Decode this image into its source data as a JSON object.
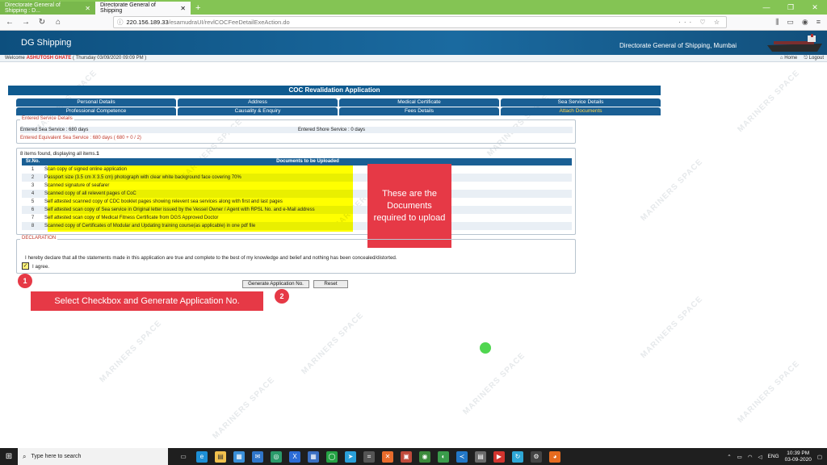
{
  "browser": {
    "tabs": [
      {
        "label": "Directorate General of Shipping : D..."
      },
      {
        "label": "Directorate General of Shipping"
      }
    ],
    "url_host": "220.156.189.33",
    "url_path": "/esamudraUI/revlCOCFeeDetailExeAction.do"
  },
  "site": {
    "logo": "DG Shipping",
    "org": "Directorate General of Shipping, Mumbai",
    "welcome": "Welcome",
    "user": "ASHUTOSH GHATE",
    "date": "( Thursday 03/09/2020 09:09 PM )",
    "home": "Home",
    "logout": "Logout"
  },
  "form": {
    "title": "COC Revalidation Application",
    "tabs_row1": [
      "Personal Details",
      "Address",
      "Medical Certificate",
      "Sea Service Details"
    ],
    "tabs_row2": [
      "Professional Competence",
      "Causality & Enquiry",
      "Fees Details",
      "Attach Documents"
    ],
    "service": {
      "legend": "Entered Service Details",
      "sea": "Entered Sea Service : 680 days",
      "shore": "Entered Shore Service : 0 days",
      "equiv": "Entered Equivalent Sea Service : 680 days  ( 680 + 0 / 2)"
    },
    "docs": {
      "found": "8 items found, displaying all items.",
      "found_page": "1",
      "col_no": "Sr.No.",
      "col_doc": "Documents to be Uploaded",
      "rows": [
        {
          "no": "1",
          "text": "Scan copy of signed online application"
        },
        {
          "no": "2",
          "text": "Passport size (3.5 cm X 3.5 cm) photograph with clear white background face covering 70%"
        },
        {
          "no": "3",
          "text": "Scanned signature of seafarer"
        },
        {
          "no": "4",
          "text": "Scanned copy of all relevent pages of CoC"
        },
        {
          "no": "5",
          "text": "Self attested scanned copy of CDC booklet pages showing relevent sea services along with first and last pages"
        },
        {
          "no": "6",
          "text": "Self attested scan copy of Sea service in Original letter issued by the Vessel Owner / Agent with RPSL No. and e-Mail address"
        },
        {
          "no": "7",
          "text": "Self attested scan copy of Medical Fitness Certificate from DGS Approved Doctor"
        },
        {
          "no": "8",
          "text": "Scanned copy of Certificates of Modular and Updating training course(as applicable) in one pdf file"
        }
      ]
    },
    "declaration": {
      "legend": "DECLARATION",
      "statement": "I hereby declare that all the statements made in this application are true and complete to the best of my knowledge and belief and nothing has been concealed/distorted.",
      "agree": "I agree."
    },
    "generate_btn": "Generate Application No.",
    "reset_btn": "Reset"
  },
  "annotations": {
    "callout_docs": "These are the Documents required to upload",
    "badge1": "1",
    "badge2": "2",
    "callout_step": "Select Checkbox and Generate Application No."
  },
  "watermark": "MARINERS SPACE",
  "taskbar": {
    "search": "Type here to search",
    "lang": "ENG",
    "time": "10:39 PM",
    "date": "03-09-2020"
  }
}
